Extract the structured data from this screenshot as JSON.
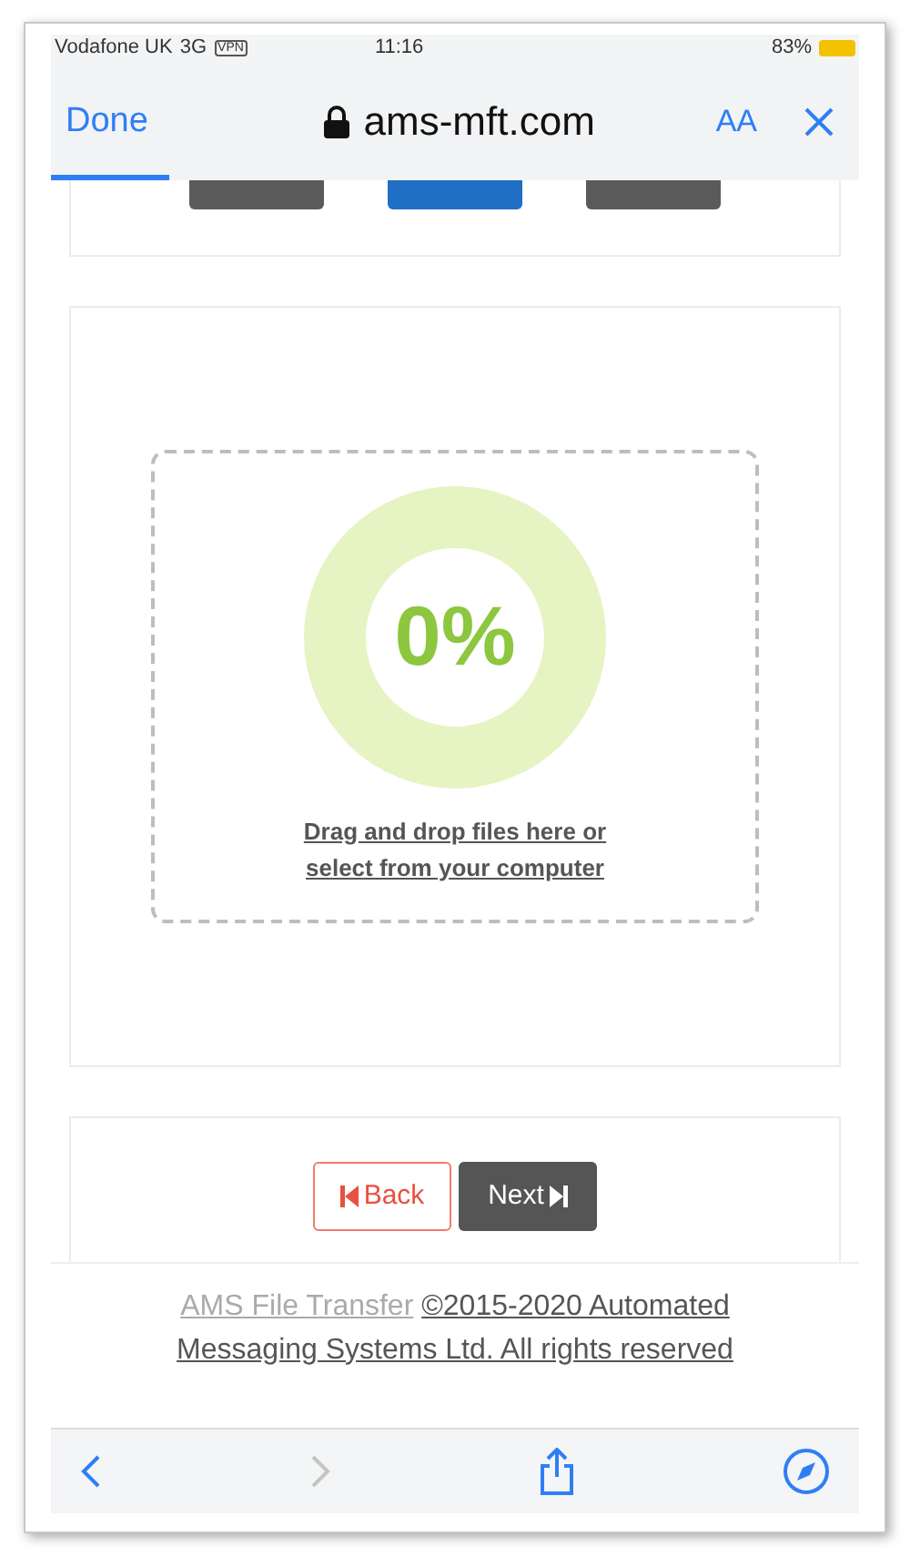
{
  "status_bar": {
    "carrier": "Vodafone UK",
    "network": "3G",
    "vpn": "VPN",
    "time": "11:16",
    "battery": "83%"
  },
  "browser_header": {
    "done": "Done",
    "url": "ams-mft.com",
    "text_size": "AA"
  },
  "steps": [
    {
      "selected": false
    },
    {
      "selected": true
    },
    {
      "selected": false
    }
  ],
  "upload": {
    "progress": "0%",
    "level": 0,
    "hint": "Drag and drop files here or select from your computer"
  },
  "nav_buttons": {
    "back": "Back",
    "next": "Next"
  },
  "footer": {
    "link": "AMS File Transfer",
    "copyright": "©2015-2020 Automated Messaging Systems Ltd. All rights reserved"
  },
  "toolbar": {
    "back_enabled": true,
    "forward_enabled": false
  }
}
